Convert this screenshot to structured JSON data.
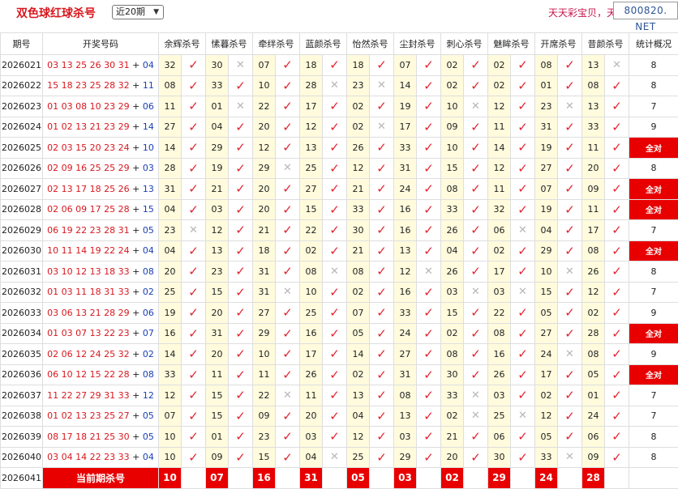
{
  "header": {
    "title": "双色球红球杀号",
    "period_select": "近20期",
    "slogan": "天天彩宝贝，天",
    "site": "800820. NET"
  },
  "table": {
    "columns": [
      "期号",
      "开奖号码",
      "余辉杀号",
      "愫暮杀号",
      "牵绊杀号",
      "蓝颜杀号",
      "怡然杀号",
      "尘封杀号",
      "刺心杀号",
      "魅眸杀号",
      "开席杀号",
      "昔颜杀号",
      "统计概况"
    ],
    "full_label": "全对",
    "current_label": "当前期杀号",
    "icons": {
      "tick": "check-icon",
      "cross": "cross-icon"
    },
    "rows": [
      {
        "issue": "2026021",
        "red": "03 13 25 26 30 31",
        "blue": "04",
        "kills": [
          [
            "32",
            1
          ],
          [
            "30",
            0
          ],
          [
            "07",
            1
          ],
          [
            "18",
            1
          ],
          [
            "18",
            1
          ],
          [
            "07",
            1
          ],
          [
            "02",
            1
          ],
          [
            "02",
            1
          ],
          [
            "08",
            1
          ],
          [
            "13",
            0
          ]
        ],
        "summary": "8"
      },
      {
        "issue": "2026022",
        "red": "15 18 23 25 28 32",
        "blue": "11",
        "kills": [
          [
            "08",
            1
          ],
          [
            "33",
            1
          ],
          [
            "10",
            1
          ],
          [
            "28",
            0
          ],
          [
            "23",
            0
          ],
          [
            "14",
            1
          ],
          [
            "02",
            1
          ],
          [
            "02",
            1
          ],
          [
            "01",
            1
          ],
          [
            "08",
            1
          ]
        ],
        "summary": "8"
      },
      {
        "issue": "2026023",
        "red": "01 03 08 10 23 29",
        "blue": "06",
        "kills": [
          [
            "11",
            1
          ],
          [
            "01",
            0
          ],
          [
            "22",
            1
          ],
          [
            "17",
            1
          ],
          [
            "02",
            1
          ],
          [
            "19",
            1
          ],
          [
            "10",
            0
          ],
          [
            "12",
            1
          ],
          [
            "23",
            0
          ],
          [
            "13",
            1
          ]
        ],
        "summary": "7"
      },
      {
        "issue": "2026024",
        "red": "01 02 13 21 23 29",
        "blue": "14",
        "kills": [
          [
            "27",
            1
          ],
          [
            "04",
            1
          ],
          [
            "20",
            1
          ],
          [
            "12",
            1
          ],
          [
            "02",
            0
          ],
          [
            "17",
            1
          ],
          [
            "09",
            1
          ],
          [
            "11",
            1
          ],
          [
            "31",
            1
          ],
          [
            "33",
            1
          ]
        ],
        "summary": "9"
      },
      {
        "issue": "2026025",
        "red": "02 03 15 20 23 24",
        "blue": "10",
        "kills": [
          [
            "14",
            1
          ],
          [
            "29",
            1
          ],
          [
            "12",
            1
          ],
          [
            "13",
            1
          ],
          [
            "26",
            1
          ],
          [
            "33",
            1
          ],
          [
            "10",
            1
          ],
          [
            "14",
            1
          ],
          [
            "19",
            1
          ],
          [
            "11",
            1
          ]
        ],
        "summary": "全对"
      },
      {
        "issue": "2026026",
        "red": "02 09 16 25 25 29",
        "blue": "03",
        "kills": [
          [
            "28",
            1
          ],
          [
            "19",
            1
          ],
          [
            "29",
            0
          ],
          [
            "25",
            1
          ],
          [
            "12",
            1
          ],
          [
            "31",
            1
          ],
          [
            "15",
            1
          ],
          [
            "12",
            1
          ],
          [
            "27",
            1
          ],
          [
            "20",
            1
          ]
        ],
        "summary": "8"
      },
      {
        "issue": "2026027",
        "red": "02 13 17 18 25 26",
        "blue": "13",
        "kills": [
          [
            "31",
            1
          ],
          [
            "21",
            1
          ],
          [
            "20",
            1
          ],
          [
            "27",
            1
          ],
          [
            "21",
            1
          ],
          [
            "24",
            1
          ],
          [
            "08",
            1
          ],
          [
            "11",
            1
          ],
          [
            "07",
            1
          ],
          [
            "09",
            1
          ]
        ],
        "summary": "全对"
      },
      {
        "issue": "2026028",
        "red": "02 06 09 17 25 28",
        "blue": "15",
        "kills": [
          [
            "04",
            1
          ],
          [
            "03",
            1
          ],
          [
            "20",
            1
          ],
          [
            "15",
            1
          ],
          [
            "33",
            1
          ],
          [
            "16",
            1
          ],
          [
            "33",
            1
          ],
          [
            "32",
            1
          ],
          [
            "19",
            1
          ],
          [
            "11",
            1
          ]
        ],
        "summary": "全对"
      },
      {
        "issue": "2026029",
        "red": "06 19 22 23 28 31",
        "blue": "05",
        "kills": [
          [
            "23",
            0
          ],
          [
            "12",
            1
          ],
          [
            "21",
            1
          ],
          [
            "22",
            1
          ],
          [
            "30",
            1
          ],
          [
            "16",
            1
          ],
          [
            "26",
            1
          ],
          [
            "06",
            0
          ],
          [
            "04",
            1
          ],
          [
            "17",
            1
          ]
        ],
        "summary": "7"
      },
      {
        "issue": "2026030",
        "red": "10 11 14 19 22 24",
        "blue": "04",
        "kills": [
          [
            "04",
            1
          ],
          [
            "13",
            1
          ],
          [
            "18",
            1
          ],
          [
            "02",
            1
          ],
          [
            "21",
            1
          ],
          [
            "13",
            1
          ],
          [
            "04",
            1
          ],
          [
            "02",
            1
          ],
          [
            "29",
            1
          ],
          [
            "08",
            1
          ]
        ],
        "summary": "全对"
      },
      {
        "issue": "2026031",
        "red": "03 10 12 13 18 33",
        "blue": "08",
        "kills": [
          [
            "20",
            1
          ],
          [
            "23",
            1
          ],
          [
            "31",
            1
          ],
          [
            "08",
            0
          ],
          [
            "08",
            1
          ],
          [
            "12",
            0
          ],
          [
            "26",
            1
          ],
          [
            "17",
            1
          ],
          [
            "10",
            0
          ],
          [
            "26",
            1
          ]
        ],
        "summary": "8"
      },
      {
        "issue": "2026032",
        "red": "01 03 11 18 31 33",
        "blue": "02",
        "kills": [
          [
            "25",
            1
          ],
          [
            "15",
            1
          ],
          [
            "31",
            0
          ],
          [
            "10",
            1
          ],
          [
            "02",
            1
          ],
          [
            "16",
            1
          ],
          [
            "03",
            0
          ],
          [
            "03",
            0
          ],
          [
            "15",
            1
          ],
          [
            "12",
            1
          ]
        ],
        "summary": "7"
      },
      {
        "issue": "2026033",
        "red": "03 06 13 21 28 29",
        "blue": "06",
        "kills": [
          [
            "19",
            1
          ],
          [
            "20",
            1
          ],
          [
            "27",
            1
          ],
          [
            "25",
            1
          ],
          [
            "07",
            1
          ],
          [
            "33",
            1
          ],
          [
            "15",
            1
          ],
          [
            "22",
            1
          ],
          [
            "05",
            1
          ],
          [
            "02",
            1
          ]
        ],
        "summary": "9"
      },
      {
        "issue": "2026034",
        "red": "01 03 07 13 22 23",
        "blue": "07",
        "kills": [
          [
            "16",
            1
          ],
          [
            "31",
            1
          ],
          [
            "29",
            1
          ],
          [
            "16",
            1
          ],
          [
            "05",
            1
          ],
          [
            "24",
            1
          ],
          [
            "02",
            1
          ],
          [
            "08",
            1
          ],
          [
            "27",
            1
          ],
          [
            "28",
            1
          ]
        ],
        "summary": "全对"
      },
      {
        "issue": "2026035",
        "red": "02 06 12 24 25 32",
        "blue": "02",
        "kills": [
          [
            "14",
            1
          ],
          [
            "20",
            1
          ],
          [
            "10",
            1
          ],
          [
            "17",
            1
          ],
          [
            "14",
            1
          ],
          [
            "27",
            1
          ],
          [
            "08",
            1
          ],
          [
            "16",
            1
          ],
          [
            "24",
            0
          ],
          [
            "08",
            1
          ]
        ],
        "summary": "9"
      },
      {
        "issue": "2026036",
        "red": "06 10 12 15 22 28",
        "blue": "08",
        "kills": [
          [
            "33",
            1
          ],
          [
            "11",
            1
          ],
          [
            "11",
            1
          ],
          [
            "26",
            1
          ],
          [
            "02",
            1
          ],
          [
            "31",
            1
          ],
          [
            "30",
            1
          ],
          [
            "26",
            1
          ],
          [
            "17",
            1
          ],
          [
            "05",
            1
          ]
        ],
        "summary": "全对"
      },
      {
        "issue": "2026037",
        "red": "11 22 27 29 31 33",
        "blue": "12",
        "kills": [
          [
            "12",
            1
          ],
          [
            "15",
            1
          ],
          [
            "22",
            0
          ],
          [
            "11",
            1
          ],
          [
            "13",
            1
          ],
          [
            "08",
            1
          ],
          [
            "33",
            0
          ],
          [
            "03",
            1
          ],
          [
            "02",
            1
          ],
          [
            "01",
            1
          ]
        ],
        "summary": "7"
      },
      {
        "issue": "2026038",
        "red": "01 02 13 23 25 27",
        "blue": "05",
        "kills": [
          [
            "07",
            1
          ],
          [
            "15",
            1
          ],
          [
            "09",
            1
          ],
          [
            "20",
            1
          ],
          [
            "04",
            1
          ],
          [
            "13",
            1
          ],
          [
            "02",
            0
          ],
          [
            "25",
            0
          ],
          [
            "12",
            1
          ],
          [
            "24",
            1
          ]
        ],
        "summary": "7"
      },
      {
        "issue": "2026039",
        "red": "08 17 18 21 25 30",
        "blue": "05",
        "kills": [
          [
            "10",
            1
          ],
          [
            "01",
            1
          ],
          [
            "23",
            1
          ],
          [
            "03",
            1
          ],
          [
            "12",
            1
          ],
          [
            "03",
            1
          ],
          [
            "21",
            1
          ],
          [
            "06",
            1
          ],
          [
            "05",
            1
          ],
          [
            "06",
            1
          ]
        ],
        "summary": "8"
      },
      {
        "issue": "2026040",
        "red": "03 04 14 22 23 33",
        "blue": "04",
        "kills": [
          [
            "10",
            1
          ],
          [
            "09",
            1
          ],
          [
            "15",
            1
          ],
          [
            "04",
            0
          ],
          [
            "25",
            1
          ],
          [
            "29",
            1
          ],
          [
            "20",
            1
          ],
          [
            "30",
            1
          ],
          [
            "33",
            0
          ],
          [
            "09",
            1
          ]
        ],
        "summary": "8"
      }
    ],
    "current": {
      "issue": "2026041",
      "kills": [
        "10",
        "07",
        "16",
        "31",
        "05",
        "03",
        "02",
        "29",
        "24",
        "28"
      ]
    }
  }
}
